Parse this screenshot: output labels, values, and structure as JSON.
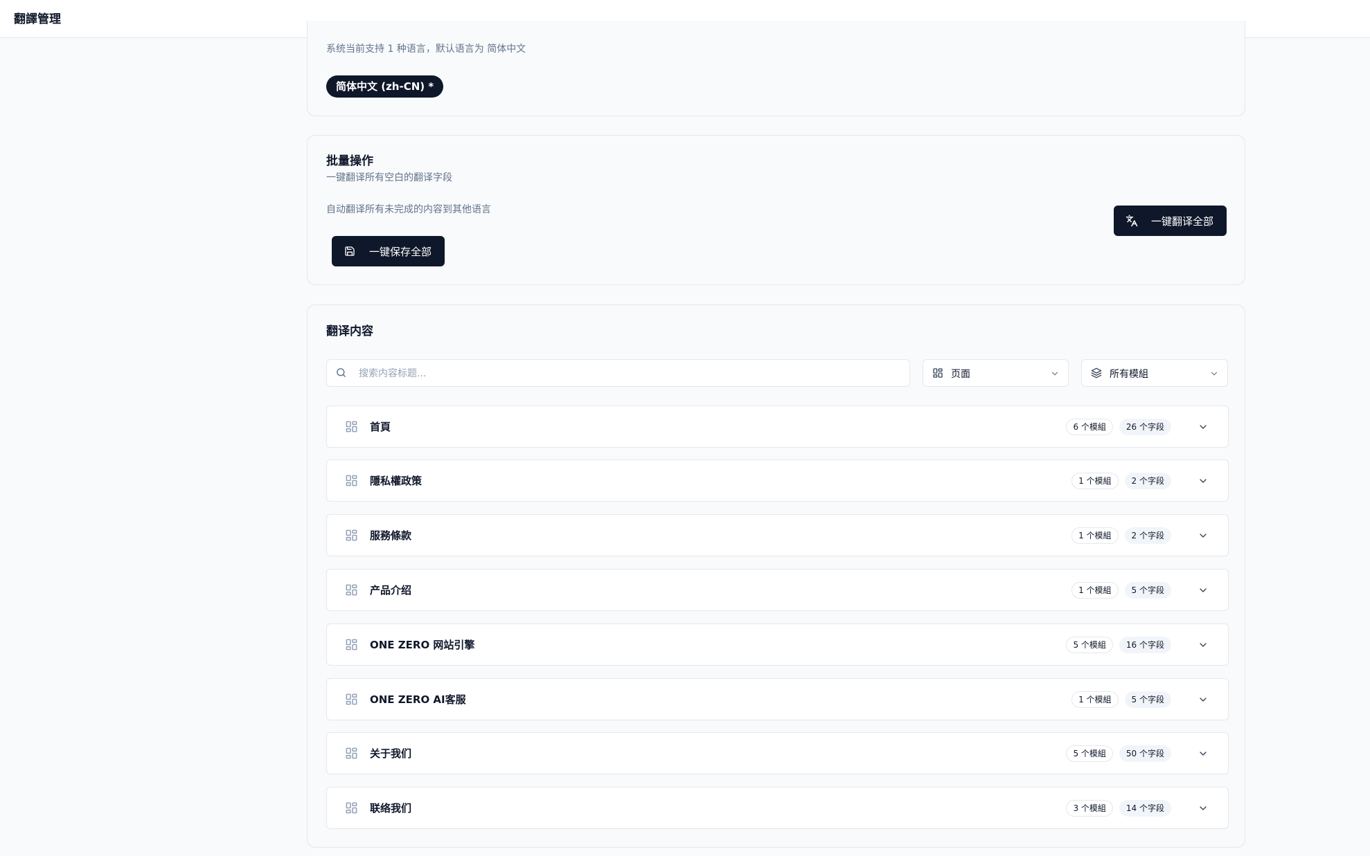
{
  "app": {
    "title": "翻譯管理"
  },
  "languages": {
    "description": "系统当前支持 1 种语言，默认语言为 简体中文",
    "pill": "简体中文 (zh-CN) *"
  },
  "batch": {
    "title": "批量操作",
    "subtitle": "一键翻译所有空白的翻译字段",
    "auto_desc": "自动翻译所有未完成的内容到其他语言",
    "save_all_label": "一键保存全部",
    "translate_all_label": "一键翻译全部"
  },
  "content": {
    "title": "翻译内容",
    "search_placeholder": "搜索内容标题...",
    "type_filter": "页面",
    "module_filter": "所有模組",
    "rows": [
      {
        "title": "首頁",
        "modules": "6 个模組",
        "fields": "26 个字段"
      },
      {
        "title": "隱私權政策",
        "modules": "1 个模組",
        "fields": "2 个字段"
      },
      {
        "title": "服務條款",
        "modules": "1 个模組",
        "fields": "2 个字段"
      },
      {
        "title": "产品介绍",
        "modules": "1 个模組",
        "fields": "5 个字段"
      },
      {
        "title": "ONE ZERO 网站引擎",
        "modules": "5 个模組",
        "fields": "16 个字段"
      },
      {
        "title": "ONE ZERO AI客服",
        "modules": "1 个模組",
        "fields": "5 个字段"
      },
      {
        "title": "关于我们",
        "modules": "5 个模組",
        "fields": "50 个字段"
      },
      {
        "title": "联络我们",
        "modules": "3 个模組",
        "fields": "14 个字段"
      }
    ]
  },
  "colors": {
    "primary": "#0f172a",
    "muted_text": "#64748b",
    "border": "#e5e7eb",
    "background": "#f8fafc"
  },
  "icons": {
    "row": "layout-grid-icon",
    "search": "search-icon",
    "type_filter": "layout-grid-icon",
    "module_filter": "layers-icon",
    "save": "save-icon",
    "translate": "languages-icon",
    "expand": "chevron-down-icon"
  }
}
